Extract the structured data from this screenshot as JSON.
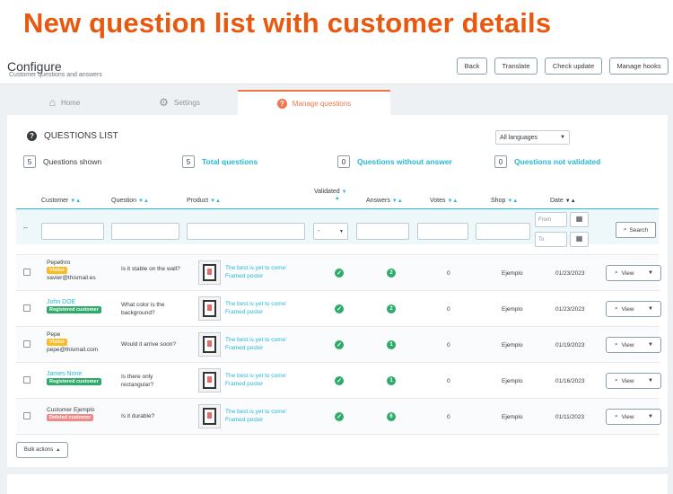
{
  "banner": {
    "headline": "New question list with customer details"
  },
  "header": {
    "title": "Configure",
    "subtitle": "Customer questions and answers",
    "buttons": [
      "Back",
      "Translate",
      "Check update",
      "Manage hooks"
    ]
  },
  "tabs": [
    {
      "label": "Home",
      "icon": "home-icon"
    },
    {
      "label": "Settings",
      "icon": "gears-icon"
    },
    {
      "label": "Manage questions",
      "icon": "question-circle-icon"
    }
  ],
  "panel": {
    "title": "QUESTIONS LIST",
    "language_select": "All languages",
    "stats": [
      {
        "value": "5",
        "label": "Questions shown"
      },
      {
        "value": "5",
        "label": "Total questions"
      },
      {
        "value": "0",
        "label": "Questions without answer"
      },
      {
        "value": "0",
        "label": "Questions not validated"
      }
    ],
    "columns": {
      "customer": "Customer",
      "question": "Question",
      "product": "Product",
      "validated": "Validated",
      "answers": "Answers",
      "votes": "Votes",
      "shop": "Shop",
      "date": "Date"
    },
    "filter": {
      "dash": "--",
      "validated_value": "-",
      "from_placeholder": "From",
      "to_placeholder": "To",
      "search_label": "Search"
    },
    "rows": [
      {
        "name": "Pepethro",
        "badge": "Visitor",
        "badge_color": "#fbbb22",
        "email": "xavier@thismail.es",
        "question": "Is it stable on the wall?",
        "product": "The best is yet to come' Framed poster",
        "answers": "2",
        "votes": "0",
        "shop": "Ejemplo",
        "date": "01/23/2023"
      },
      {
        "name": "John DOE",
        "badge": "Registered customer",
        "badge_color": "#2eaa6a",
        "email": "",
        "question": "What color is the background?",
        "product": "The best is yet to come' Framed poster",
        "answers": "2",
        "votes": "0",
        "shop": "Ejemplo",
        "date": "01/23/2023"
      },
      {
        "name": "Pepe",
        "badge": "Visitor",
        "badge_color": "#fbbb22",
        "email": "pepe@thismail.com",
        "question": "Would it arrive soon?",
        "product": "The best is yet to come' Framed poster",
        "answers": "1",
        "votes": "0",
        "shop": "Ejemplo",
        "date": "01/19/2023"
      },
      {
        "name": "James None",
        "badge": "Registered customer",
        "badge_color": "#2eaa6a",
        "email": "",
        "question": "Is there only rectangular?",
        "product": "The best is yet to come' Framed poster",
        "answers": "1",
        "votes": "0",
        "shop": "Ejemplo",
        "date": "01/16/2023"
      },
      {
        "name": "Customer Ejemplo",
        "badge": "Deleted customer",
        "badge_color": "#f08a8a",
        "email": "",
        "question": "Is it durable?",
        "product": "The best is yet to come' Framed poster",
        "answers": "6",
        "votes": "0",
        "shop": "Ejemplo",
        "date": "01/11/2023"
      }
    ],
    "view_label": "View",
    "bulk_label": "Bulk actions"
  }
}
